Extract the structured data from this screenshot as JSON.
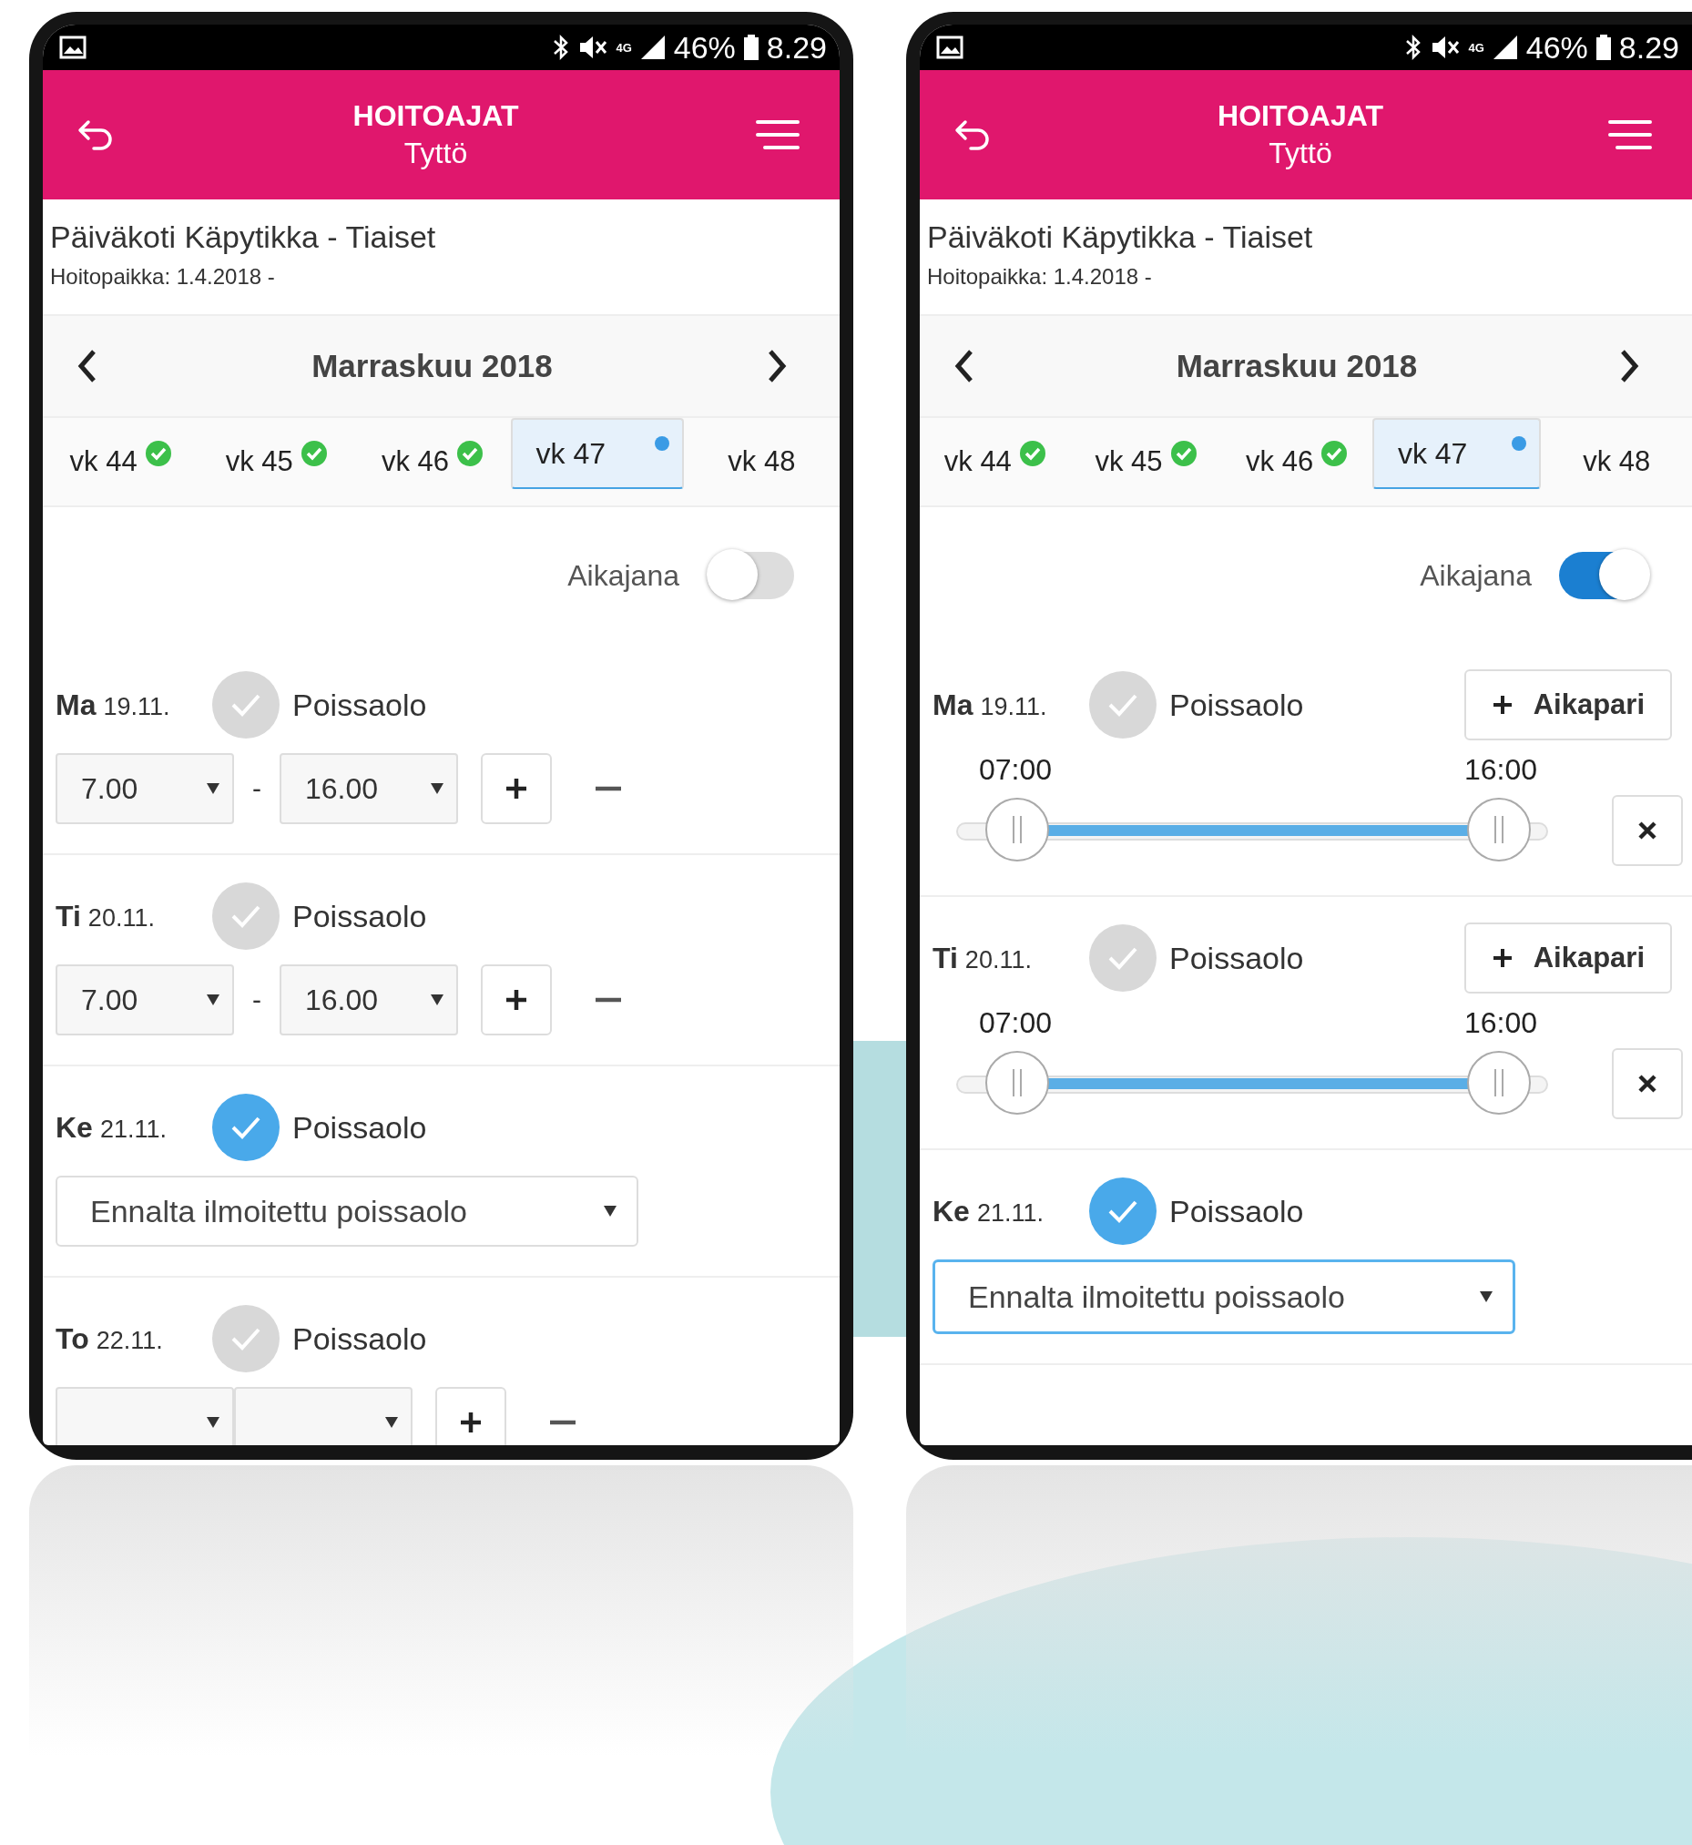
{
  "phones": [
    {
      "status_bar": {
        "network": "4G",
        "battery": "46%",
        "time": "8.29"
      },
      "header": {
        "title": "HOITOAJAT",
        "subtitle": "Tyttö"
      },
      "place": {
        "name": "Päiväkoti Käpytikka - Tiaiset",
        "period": "Hoitopaikka: 1.4.2018 -"
      },
      "month": "Marraskuu 2018",
      "weeks": [
        {
          "label": "vk 44",
          "kind": "done",
          "selected": false
        },
        {
          "label": "vk 45",
          "kind": "done",
          "selected": false
        },
        {
          "label": "vk 46",
          "kind": "done",
          "selected": false
        },
        {
          "label": "vk 47",
          "kind": "pending",
          "selected": true
        },
        {
          "label": "vk 48",
          "kind": "plain",
          "selected": false
        }
      ],
      "timeline": {
        "label": "Aikajana",
        "on": false
      },
      "days": [
        {
          "kind": "select_times",
          "day": "Ma",
          "date": "19.11.",
          "absence_label": "Poissaolo",
          "absent": false,
          "start": "7.00",
          "separator": "-",
          "end": "16.00"
        },
        {
          "kind": "select_times",
          "day": "Ti",
          "date": "20.11.",
          "absence_label": "Poissaolo",
          "absent": false,
          "start": "7.00",
          "separator": "-",
          "end": "16.00"
        },
        {
          "kind": "absence",
          "day": "Ke",
          "date": "21.11.",
          "absence_label": "Poissaolo",
          "absent": true,
          "reason": "Ennalta ilmoitettu poissaolo",
          "focused": false
        },
        {
          "kind": "select_times",
          "day": "To",
          "date": "22.11.",
          "absence_label": "Poissaolo",
          "absent": false
        }
      ]
    },
    {
      "status_bar": {
        "network": "4G",
        "battery": "46%",
        "time": "8.29"
      },
      "header": {
        "title": "HOITOAJAT",
        "subtitle": "Tyttö"
      },
      "place": {
        "name": "Päiväkoti Käpytikka - Tiaiset",
        "period": "Hoitopaikka: 1.4.2018 -"
      },
      "month": "Marraskuu 2018",
      "weeks": [
        {
          "label": "vk 44",
          "kind": "done",
          "selected": false
        },
        {
          "label": "vk 45",
          "kind": "done",
          "selected": false
        },
        {
          "label": "vk 46",
          "kind": "done",
          "selected": false
        },
        {
          "label": "vk 47",
          "kind": "pending",
          "selected": true
        },
        {
          "label": "vk 48",
          "kind": "plain",
          "selected": false
        }
      ],
      "timeline": {
        "label": "Aikajana",
        "on": true
      },
      "days": [
        {
          "kind": "slider",
          "day": "Ma",
          "date": "19.11.",
          "absence_label": "Poissaolo",
          "absent": false,
          "add_label": "Aikapari",
          "range": {
            "start": {
              "label": "07:00",
              "level": 0.1
            },
            "end": {
              "label": "16:00",
              "level": 0.92
            }
          }
        },
        {
          "kind": "slider",
          "day": "Ti",
          "date": "20.11.",
          "absence_label": "Poissaolo",
          "absent": false,
          "add_label": "Aikapari",
          "range": {
            "start": {
              "label": "07:00",
              "level": 0.1
            },
            "end": {
              "label": "16:00",
              "level": 0.92
            }
          }
        },
        {
          "kind": "absence",
          "day": "Ke",
          "date": "21.11.",
          "absence_label": "Poissaolo",
          "absent": true,
          "reason": "Ennalta ilmoitettu poissaolo",
          "focused": true
        }
      ]
    }
  ]
}
